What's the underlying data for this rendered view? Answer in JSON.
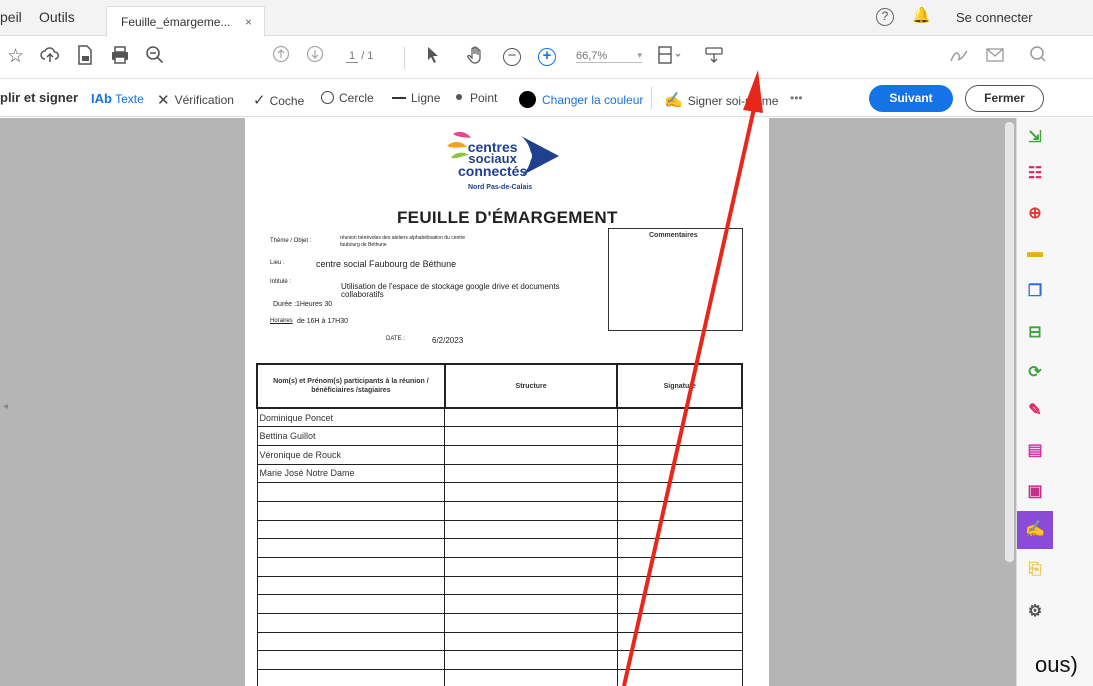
{
  "tabbar": {
    "home_partial": "peil",
    "tools": "Outils",
    "active_tab": "Feuille_émargeme...",
    "tab_close": "×",
    "help": "?",
    "signin": "Se connecter"
  },
  "toolbar": {
    "page_current": "1",
    "page_total": "/ 1",
    "zoom": "66,7%",
    "icons": [
      "star-icon",
      "upload-icon",
      "file-icon",
      "print-icon",
      "magnifier-icon",
      "prev-page-icon",
      "next-page-icon",
      "select-arrow-icon",
      "hand-icon",
      "zoom-out-icon",
      "zoom-in-icon",
      "fit-page-icon",
      "keyboard-icon",
      "sign-icon",
      "mail-icon",
      "search-icon"
    ]
  },
  "signbar": {
    "title": "plir et signer",
    "text_tool": "Texte",
    "text_tool_icon": "IAb",
    "verification": "Vérification",
    "check": "Coche",
    "circle": "Cercle",
    "line": "Ligne",
    "point": "Point",
    "change_color": "Changer la couleur",
    "sign_self": "Signer soi-même",
    "more": "•••",
    "next_button": "Suivant",
    "close_button": "Fermer"
  },
  "document": {
    "logo_line1": "centres",
    "logo_line2": "sociaux",
    "logo_line3": "connectés",
    "logo_sub": "Nord Pas-de-Calais",
    "title": "FEUILLE D'ÉMARGEMENT",
    "comments_label": "Commentaires",
    "theme_label": "Thème / Objet :",
    "theme_value_1": "réunion bénévoles des ateliers alphabétisation du centre",
    "theme_value_2": "faubourg de Béthune",
    "lieu_label": "Lieu :",
    "lieu_value": "centre social Faubourg de Béthune",
    "intitule_label": "Intitulé :",
    "intitule_value_1": "Utilisation de l'espace de stockage google drive et documents",
    "intitule_value_2": "collaboratifs",
    "duree": "Durée :1Heures 30",
    "horaires_label": "Horaires",
    "horaires_value": "de 16H à 17H30",
    "date_label": "DATE :",
    "date_value": "6/2/2023",
    "table": {
      "headers": [
        "Nom(s) et Prénom(s) participants à la réunion / bénéficiaires /stagiaires",
        "Structure",
        "Signature"
      ],
      "rows": [
        [
          "Dominique Poncet",
          "",
          ""
        ],
        [
          "Bettina Guillot",
          "",
          ""
        ],
        [
          "Véronique de Rouck",
          "",
          ""
        ],
        [
          "Marie José Notre Dame",
          "",
          ""
        ],
        [
          "",
          "",
          ""
        ],
        [
          "",
          "",
          ""
        ],
        [
          "",
          "",
          ""
        ],
        [
          "",
          "",
          ""
        ],
        [
          "",
          "",
          ""
        ],
        [
          "",
          "",
          ""
        ],
        [
          "",
          "",
          ""
        ],
        [
          "",
          "",
          ""
        ],
        [
          "",
          "",
          ""
        ],
        [
          "",
          "",
          ""
        ],
        [
          "",
          "",
          ""
        ]
      ]
    }
  },
  "rail": {
    "icons": [
      "export-pdf-icon",
      "organize-pages-icon",
      "create-pdf-icon",
      "comment-icon",
      "combine-files-icon",
      "compress-pdf-icon",
      "scan-ocr-icon",
      "edit-pdf-icon",
      "export-file-icon",
      "protect-icon",
      "fill-sign-icon",
      "send-file-icon",
      "more-tools-icon"
    ]
  },
  "cutoff_text": "ous)",
  "colors": {
    "accent": "#1473e6",
    "annotation_arrow": "#e8261a",
    "rail_active": "#8c4ad8"
  }
}
